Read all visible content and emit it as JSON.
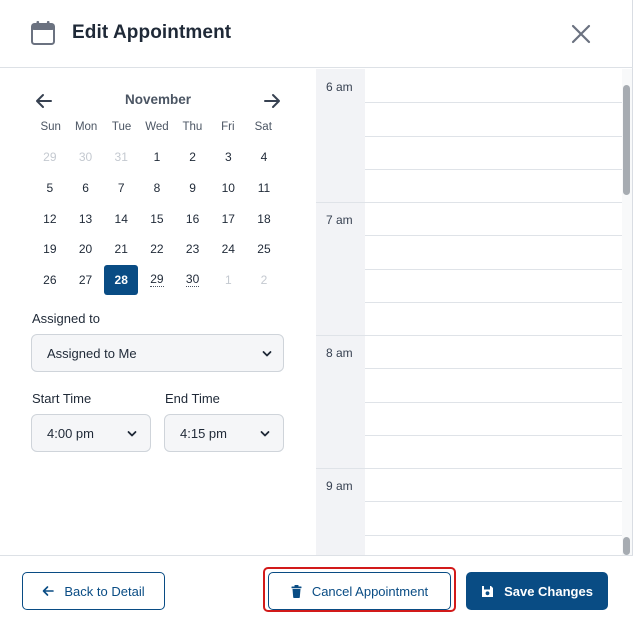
{
  "header": {
    "title": "Edit Appointment",
    "calendar_icon": "calendar-icon",
    "close_icon": "close-icon"
  },
  "calendar": {
    "month": "November",
    "weekdays": [
      "Sun",
      "Mon",
      "Tue",
      "Wed",
      "Thu",
      "Fri",
      "Sat"
    ],
    "days": [
      {
        "label": "29",
        "muted": true
      },
      {
        "label": "30",
        "muted": true
      },
      {
        "label": "31",
        "muted": true
      },
      {
        "label": "1"
      },
      {
        "label": "2"
      },
      {
        "label": "3"
      },
      {
        "label": "4"
      },
      {
        "label": "5"
      },
      {
        "label": "6"
      },
      {
        "label": "7"
      },
      {
        "label": "8"
      },
      {
        "label": "9"
      },
      {
        "label": "10"
      },
      {
        "label": "11"
      },
      {
        "label": "12"
      },
      {
        "label": "13"
      },
      {
        "label": "14"
      },
      {
        "label": "15"
      },
      {
        "label": "16"
      },
      {
        "label": "17"
      },
      {
        "label": "18"
      },
      {
        "label": "19"
      },
      {
        "label": "20"
      },
      {
        "label": "21"
      },
      {
        "label": "22"
      },
      {
        "label": "23"
      },
      {
        "label": "24"
      },
      {
        "label": "25"
      },
      {
        "label": "26"
      },
      {
        "label": "27"
      },
      {
        "label": "28",
        "selected": true
      },
      {
        "label": "29",
        "dotted": true
      },
      {
        "label": "30",
        "dotted": true
      },
      {
        "label": "1",
        "muted": true
      },
      {
        "label": "2",
        "muted": true
      }
    ]
  },
  "form": {
    "assigned_label": "Assigned to",
    "assigned_value": "Assigned to Me",
    "start_label": "Start Time",
    "start_value": "4:00 pm",
    "end_label": "End Time",
    "end_value": "4:15 pm"
  },
  "timeline": {
    "hours": [
      "6 am",
      "7 am",
      "8 am",
      "9 am"
    ]
  },
  "footer": {
    "back_label": "Back to Detail",
    "cancel_label": "Cancel Appointment",
    "save_label": "Save Changes"
  },
  "colors": {
    "primary": "#094c84",
    "highlight_outline": "#d21a1a"
  }
}
